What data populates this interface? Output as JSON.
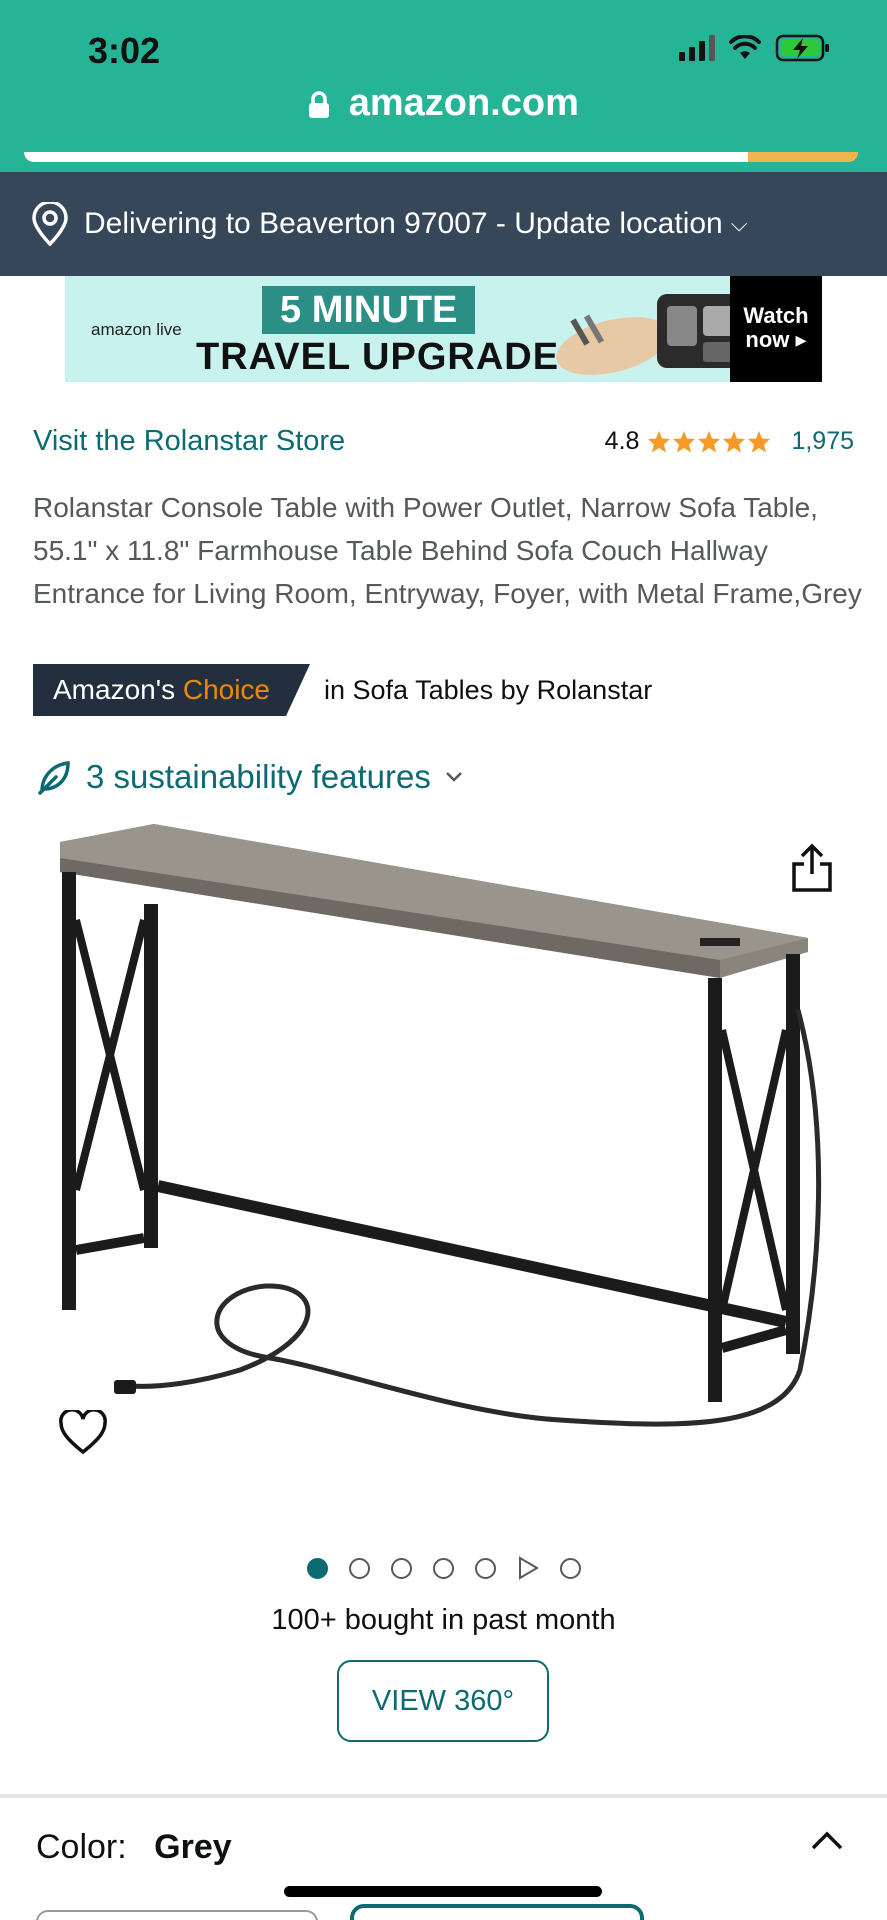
{
  "status_bar": {
    "time": "3:02"
  },
  "browser": {
    "url": "amazon.com"
  },
  "location": {
    "text": "Delivering to Beaverton 97007 - Update location"
  },
  "ad": {
    "logo": "amazon live",
    "headline_1": "5 MINUTE",
    "headline_2": "TRAVEL UPGRADE",
    "cta_1": "Watch",
    "cta_2": "now ▸"
  },
  "store": {
    "link": "Visit the Rolanstar Store",
    "rating": "4.8",
    "stars": 4.8,
    "review_count": "1,975"
  },
  "product": {
    "title": "Rolanstar Console Table with Power Outlet, Narrow Sofa Table, 55.1\" x 11.8\" Farmhouse Table Behind Sofa Couch Hallway Entrance for Living Room, Entryway, Foyer, with Metal Frame,Grey"
  },
  "badge": {
    "prefix": "Amazon's",
    "highlight": "Choice",
    "category_text": "in Sofa Tables by Rolanstar"
  },
  "sustainability": {
    "label": "3 sustainability features"
  },
  "carousel": {
    "active_index": 0,
    "total": 7
  },
  "social_proof": {
    "text": "100+ bought in past month"
  },
  "view360": {
    "label": "VIEW 360°"
  },
  "variation": {
    "label": "Color:",
    "value": "Grey"
  },
  "colors": {
    "header_bg": "#26b497",
    "location_bg": "#37475a",
    "link": "#0b6a72",
    "choice_orange": "#f08804",
    "star": "#f49a25"
  }
}
